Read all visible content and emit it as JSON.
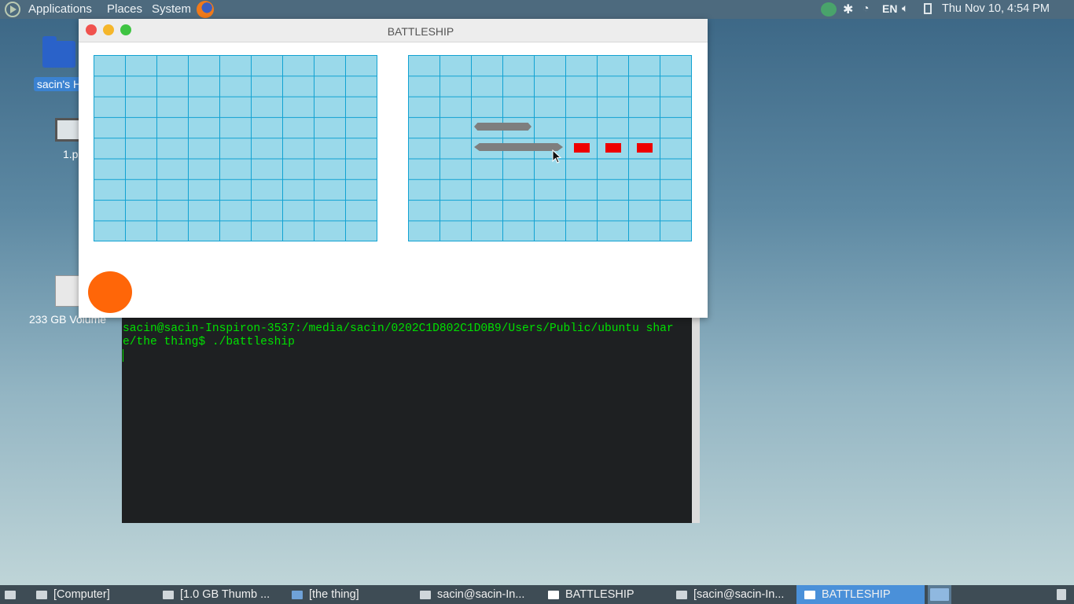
{
  "top_panel": {
    "menus": [
      "Applications",
      "Places",
      "System"
    ],
    "tray": {
      "language": "EN",
      "clock": "Thu Nov 10,  4:54 PM"
    }
  },
  "desktop": {
    "icons": [
      {
        "label": "sacin's H",
        "icon": "home-folder-icon"
      },
      {
        "label": "1.p",
        "icon": "computer-icon"
      },
      {
        "label": "233 GB Volume",
        "icon": "drive-icon"
      }
    ]
  },
  "battleship": {
    "title": "BATTLESHIP",
    "colors": {
      "water": "#9ad9ea",
      "gridline": "#12a2d2",
      "hit": "#ee0000",
      "ship": "#7e7e7e",
      "turn_indicator": "#ff6608"
    }
  },
  "terminal": {
    "line1": "sacin@sacin-Inspiron-3537:/media/sacin/0202C1D802C1D0B9/Users/Public/ubuntu shar",
    "line2": "e/the thing$ ./battleship"
  },
  "taskbar": {
    "tasks": [
      "[Computer]",
      "[1.0 GB Thumb ...",
      "[the thing]",
      "sacin@sacin-In...",
      "BATTLESHIP",
      "[sacin@sacin-In...",
      "BATTLESHIP"
    ]
  }
}
